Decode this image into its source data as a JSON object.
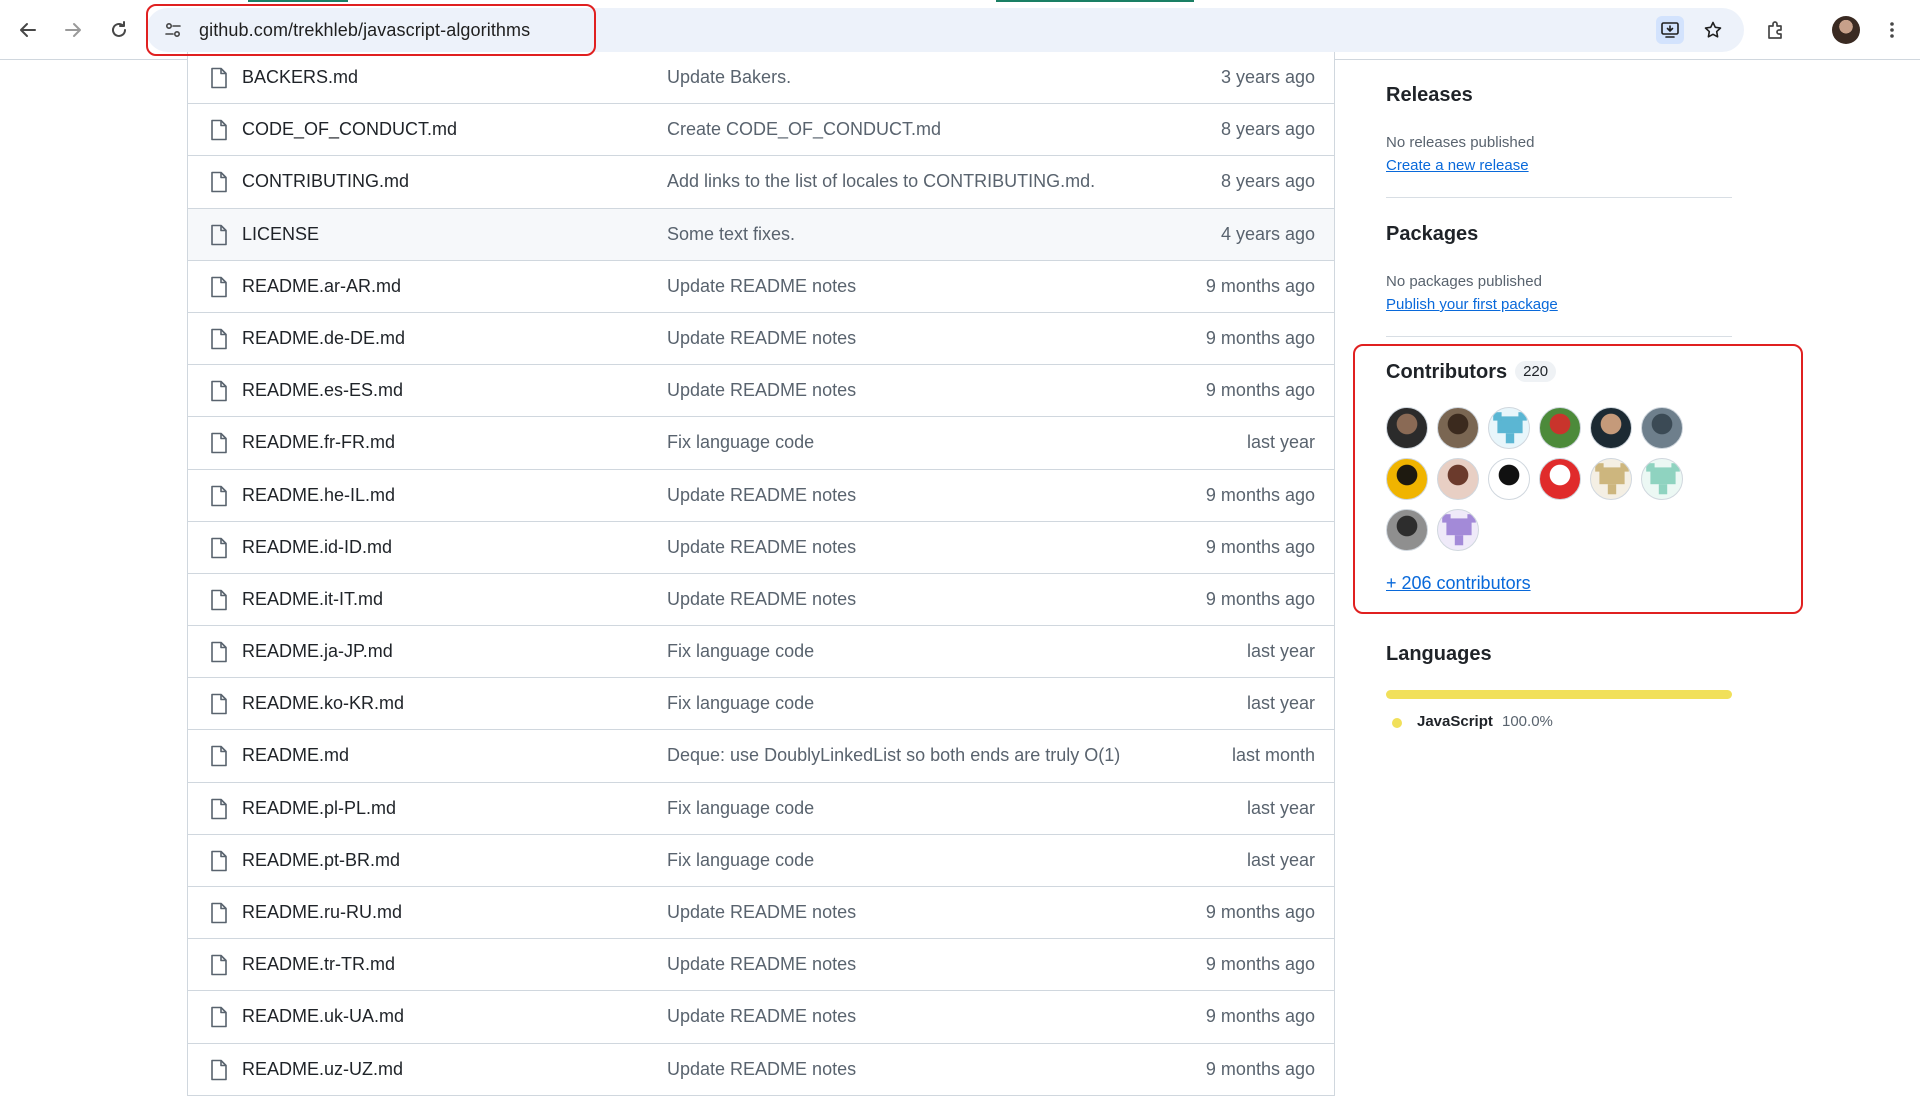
{
  "browser": {
    "url": "github.com/trekhleb/javascript-algorithms"
  },
  "files": [
    {
      "name": "BACKERS.md",
      "message": "Update Bakers.",
      "time": "3 years ago"
    },
    {
      "name": "CODE_OF_CONDUCT.md",
      "message": "Create CODE_OF_CONDUCT.md",
      "time": "8 years ago"
    },
    {
      "name": "CONTRIBUTING.md",
      "message": "Add links to the list of locales to CONTRIBUTING.md.",
      "time": "8 years ago"
    },
    {
      "name": "LICENSE",
      "message": "Some text fixes.",
      "time": "4 years ago"
    },
    {
      "name": "README.ar-AR.md",
      "message": "Update README notes",
      "time": "9 months ago"
    },
    {
      "name": "README.de-DE.md",
      "message": "Update README notes",
      "time": "9 months ago"
    },
    {
      "name": "README.es-ES.md",
      "message": "Update README notes",
      "time": "9 months ago"
    },
    {
      "name": "README.fr-FR.md",
      "message": "Fix language code",
      "time": "last year"
    },
    {
      "name": "README.he-IL.md",
      "message": "Update README notes",
      "time": "9 months ago"
    },
    {
      "name": "README.id-ID.md",
      "message": "Update README notes",
      "time": "9 months ago"
    },
    {
      "name": "README.it-IT.md",
      "message": "Update README notes",
      "time": "9 months ago"
    },
    {
      "name": "README.ja-JP.md",
      "message": "Fix language code",
      "time": "last year"
    },
    {
      "name": "README.ko-KR.md",
      "message": "Fix language code",
      "time": "last year"
    },
    {
      "name": "README.md",
      "message": "Deque: use DoublyLinkedList so both ends are truly O(1)",
      "time": "last month"
    },
    {
      "name": "README.pl-PL.md",
      "message": "Fix language code",
      "time": "last year"
    },
    {
      "name": "README.pt-BR.md",
      "message": "Fix language code",
      "time": "last year"
    },
    {
      "name": "README.ru-RU.md",
      "message": "Update README notes",
      "time": "9 months ago"
    },
    {
      "name": "README.tr-TR.md",
      "message": "Update README notes",
      "time": "9 months ago"
    },
    {
      "name": "README.uk-UA.md",
      "message": "Update README notes",
      "time": "9 months ago"
    },
    {
      "name": "README.uz-UZ.md",
      "message": "Update README notes",
      "time": "9 months ago"
    }
  ],
  "sidebar": {
    "releases": {
      "title": "Releases",
      "status": "No releases published",
      "link": "Create a new release"
    },
    "packages": {
      "title": "Packages",
      "status": "No packages published",
      "link": "Publish your first package"
    },
    "contributors": {
      "title": "Contributors",
      "count": "220",
      "more_link": "+ 206 contributors",
      "avatars": [
        {
          "kind": "photo",
          "bg": "#2b2b2b",
          "fg": "#8a6a55"
        },
        {
          "kind": "photo",
          "bg": "#7a6652",
          "fg": "#3b2a1e"
        },
        {
          "kind": "identicon",
          "bg": "#e8f6fb",
          "fg": "#5bb6d3"
        },
        {
          "kind": "photo",
          "bg": "#4c8a3a",
          "fg": "#c9342c"
        },
        {
          "kind": "photo",
          "bg": "#1c2a33",
          "fg": "#c59a7a"
        },
        {
          "kind": "photo",
          "bg": "#6e7f8c",
          "fg": "#3b4a55"
        },
        {
          "kind": "photo",
          "bg": "#f0b400",
          "fg": "#1e1a10"
        },
        {
          "kind": "photo",
          "bg": "#e8cfc4",
          "fg": "#6b3a2c"
        },
        {
          "kind": "photo",
          "bg": "#ffffff",
          "fg": "#111111"
        },
        {
          "kind": "photo",
          "bg": "#e02b2b",
          "fg": "#ffffff"
        },
        {
          "kind": "identicon",
          "bg": "#f4efe4",
          "fg": "#cdb67e"
        },
        {
          "kind": "identicon",
          "bg": "#ecf8f4",
          "fg": "#8fd3c0"
        },
        {
          "kind": "photo",
          "bg": "#8f8f8f",
          "fg": "#2d2d2d"
        },
        {
          "kind": "identicon",
          "bg": "#efeaf9",
          "fg": "#a38ad8"
        }
      ]
    },
    "languages": {
      "title": "Languages",
      "items": [
        {
          "name": "JavaScript",
          "percent": "100.0%",
          "color": "#f1e05a"
        }
      ]
    }
  }
}
